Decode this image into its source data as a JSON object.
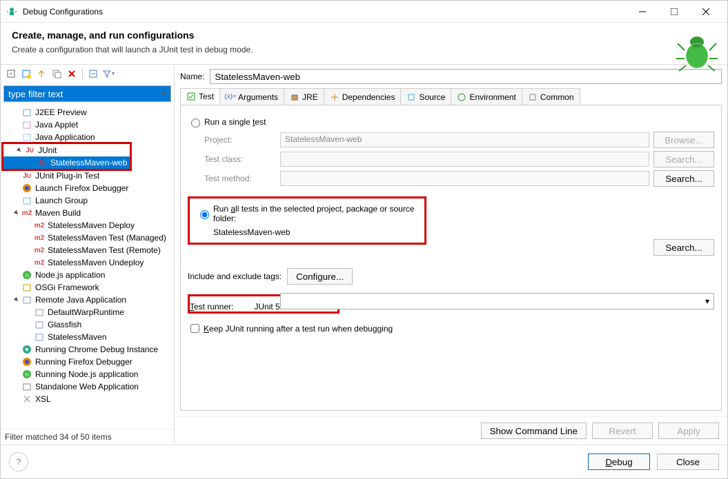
{
  "window": {
    "title": "Debug Configurations"
  },
  "header": {
    "title": "Create, manage, and run configurations",
    "subtitle": "Create a configuration that will launch a JUnit test in debug mode."
  },
  "toolbar_icons": [
    "new-config",
    "new-prototype",
    "export",
    "duplicate",
    "delete",
    "collapse-all",
    "filter-dropdown"
  ],
  "filter_field": {
    "placeholder": "type filter text"
  },
  "tree": [
    {
      "label": "J2EE Preview",
      "icon": "server",
      "depth": 0
    },
    {
      "label": "Java Applet",
      "icon": "applet",
      "depth": 0
    },
    {
      "label": "Java Application",
      "icon": "java-app",
      "depth": 0
    },
    {
      "label": "JUnit",
      "icon": "junit",
      "depth": 0,
      "expander": "open",
      "hl": "start"
    },
    {
      "label": "StatelessMaven-web",
      "icon": "junit",
      "depth": 1,
      "selected": true,
      "hl": "end"
    },
    {
      "label": "JUnit Plug-in Test",
      "icon": "junit",
      "depth": 0
    },
    {
      "label": "Launch Firefox Debugger",
      "icon": "firefox",
      "depth": 0
    },
    {
      "label": "Launch Group",
      "icon": "group",
      "depth": 0
    },
    {
      "label": "Maven Build",
      "icon": "m2",
      "depth": 0,
      "expander": "open"
    },
    {
      "label": "StatelessMaven Deploy",
      "icon": "m2",
      "depth": 1
    },
    {
      "label": "StatelessMaven Test (Managed)",
      "icon": "m2",
      "depth": 1
    },
    {
      "label": "StatelessMaven Test (Remote)",
      "icon": "m2",
      "depth": 1
    },
    {
      "label": "StatelessMaven Undeploy",
      "icon": "m2",
      "depth": 1
    },
    {
      "label": "Node.js application",
      "icon": "node",
      "depth": 0
    },
    {
      "label": "OSGi Framework",
      "icon": "osgi",
      "depth": 0
    },
    {
      "label": "Remote Java Application",
      "icon": "remote",
      "depth": 0,
      "expander": "open"
    },
    {
      "label": "DefaultWarpRuntime",
      "icon": "remote-child",
      "depth": 1
    },
    {
      "label": "Glassfish",
      "icon": "remote-child",
      "depth": 1
    },
    {
      "label": "StatelessMaven",
      "icon": "remote-child",
      "depth": 1
    },
    {
      "label": "Running Chrome Debug Instance",
      "icon": "chrome",
      "depth": 0
    },
    {
      "label": "Running Firefox Debugger",
      "icon": "firefox",
      "depth": 0
    },
    {
      "label": "Running Node.js application",
      "icon": "node",
      "depth": 0
    },
    {
      "label": "Standalone Web Application",
      "icon": "web",
      "depth": 0
    },
    {
      "label": "XSL",
      "icon": "xsl",
      "depth": 0
    }
  ],
  "filter_status": "Filter matched 34 of 50 items",
  "name_field": {
    "label": "Name:",
    "value": "StatelessMaven-web"
  },
  "tabs": [
    {
      "id": "test",
      "label": "Test",
      "active": true
    },
    {
      "id": "arguments",
      "label": "Arguments"
    },
    {
      "id": "jre",
      "label": "JRE"
    },
    {
      "id": "dependencies",
      "label": "Dependencies"
    },
    {
      "id": "source",
      "label": "Source"
    },
    {
      "id": "environment",
      "label": "Environment"
    },
    {
      "id": "common",
      "label": "Common"
    }
  ],
  "test_tab": {
    "radio_single": {
      "label_parts": [
        "Run a single ",
        "t",
        "est"
      ],
      "checked": false
    },
    "project": {
      "label": "Project:",
      "value": "StatelessMaven-web",
      "button": "Browse..."
    },
    "test_class": {
      "label": "Test class:",
      "value": "",
      "button": "Search..."
    },
    "test_method": {
      "label": "Test method:",
      "value": "",
      "button": "Search..."
    },
    "radio_all": {
      "label_parts": [
        "Run ",
        "a",
        "ll tests in the selected project, package or source folder:"
      ],
      "checked": true
    },
    "all_value": "StatelessMaven-web",
    "all_button": "Search...",
    "tags_label": "Include and exclude tags:",
    "tags_button": "Configure...",
    "runner_label_parts": [
      "T",
      "est runner:"
    ],
    "runner_value": "JUnit 5",
    "keep_running_parts": [
      "K",
      "eep JUnit running after a test run when debugging"
    ],
    "keep_running_checked": false
  },
  "btnbar": {
    "show": "Show Command Line",
    "revert": "Revert",
    "apply": "Apply"
  },
  "footer": {
    "debug": "Debug",
    "close": "Close"
  }
}
